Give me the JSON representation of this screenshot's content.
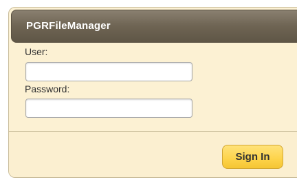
{
  "dialog": {
    "title": "PGRFileManager"
  },
  "form": {
    "user_label": "User:",
    "user_value": "",
    "password_label": "Password:",
    "password_value": ""
  },
  "actions": {
    "signin_label": "Sign In"
  },
  "colors": {
    "panel_bg": "#fcf1d3",
    "titlebar": "#6e6453",
    "button": "#fdd34a"
  }
}
